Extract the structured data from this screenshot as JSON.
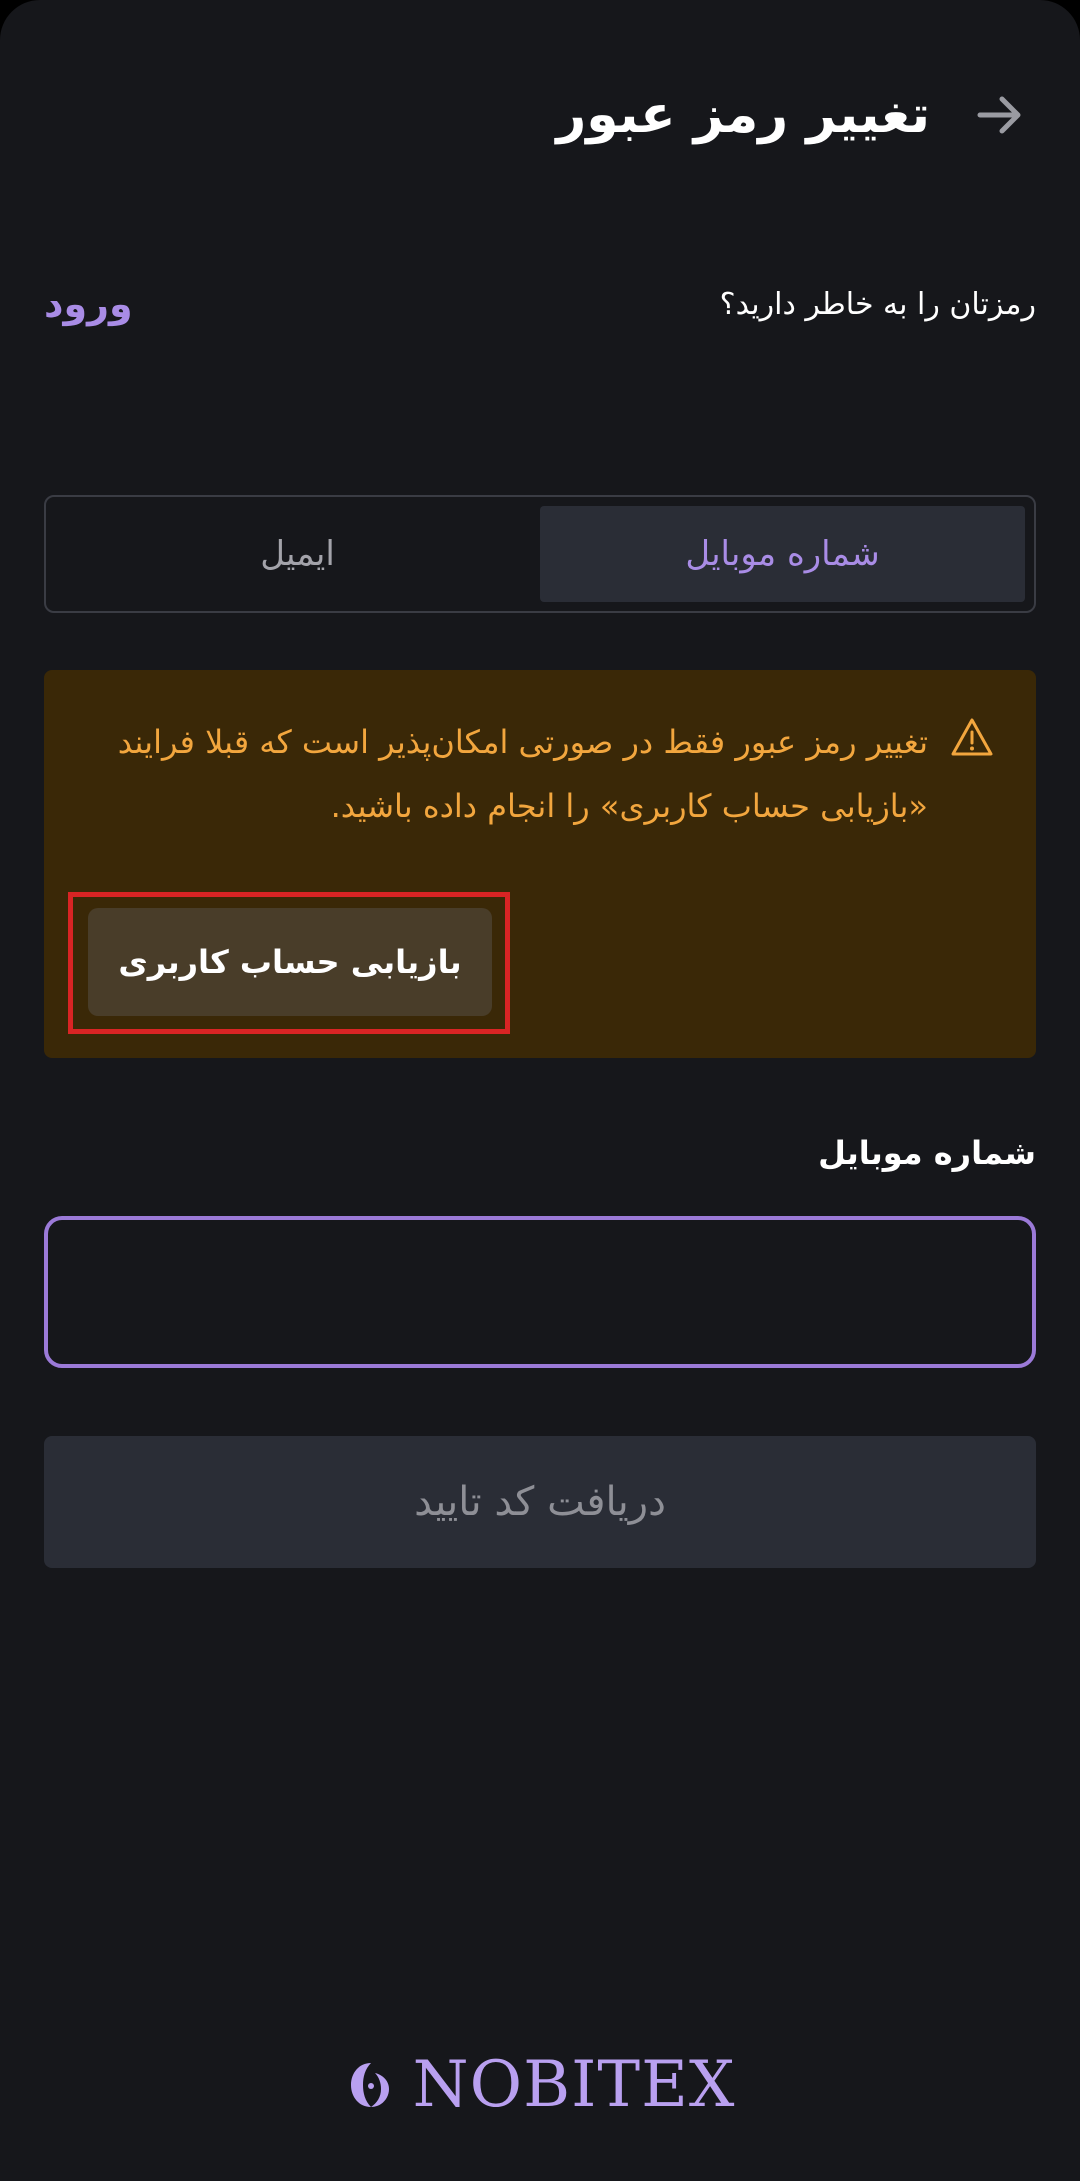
{
  "header": {
    "title": "تغییر رمز عبور",
    "back_icon": "arrow-right-icon"
  },
  "remember": {
    "question": "رمزتان را به خاطر دارید؟",
    "login_label": "ورود"
  },
  "tabs": [
    {
      "label": "شماره موبایل",
      "active": true
    },
    {
      "label": "ایمیل",
      "active": false
    }
  ],
  "warning": {
    "icon": "warning-triangle-icon",
    "text": "تغییر رمز عبور فقط در صورتی امکان‌پذیر است که قبلا فرایند «بازیابی حساب کاربری» را انجام داده باشید.",
    "button_label": "بازیابی حساب کاربری"
  },
  "mobile_field": {
    "label": "شماره موبایل",
    "value": ""
  },
  "submit": {
    "label": "دریافت کد تایید"
  },
  "logo": {
    "text": "NOBITEX",
    "icon": "nobitex-logo-icon"
  },
  "colors": {
    "background": "#16171b",
    "accent": "#a98ce6",
    "warning_bg": "#3a2807",
    "warning_text": "#f2a63e",
    "highlight_outline": "#d92424"
  }
}
